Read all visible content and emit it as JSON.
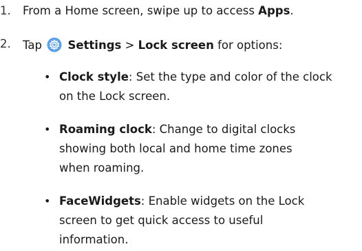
{
  "steps": [
    {
      "number": "1.",
      "pre": "From a Home screen, swipe up to access ",
      "bold": "Apps",
      "post": "."
    },
    {
      "number": "2.",
      "pre": "Tap",
      "bold_settings": "Settings",
      "separator": ">",
      "bold_lock": "Lock screen",
      "post": "for options:"
    }
  ],
  "options": [
    {
      "bullet": "•",
      "term": "Clock style",
      "lines": [
        ": Set the type and color of the clock",
        "on the Lock screen."
      ]
    },
    {
      "bullet": "•",
      "term": "Roaming clock",
      "lines": [
        ": Change to digital clocks",
        "showing both local and home time zones",
        "when roaming."
      ]
    },
    {
      "bullet": "•",
      "term": "FaceWidgets",
      "lines": [
        ": Enable widgets on the Lock",
        "screen to get quick access to useful",
        "information."
      ]
    }
  ],
  "icons": {
    "settings": "settings-gear-icon",
    "settings_color": "#4a90e2"
  }
}
